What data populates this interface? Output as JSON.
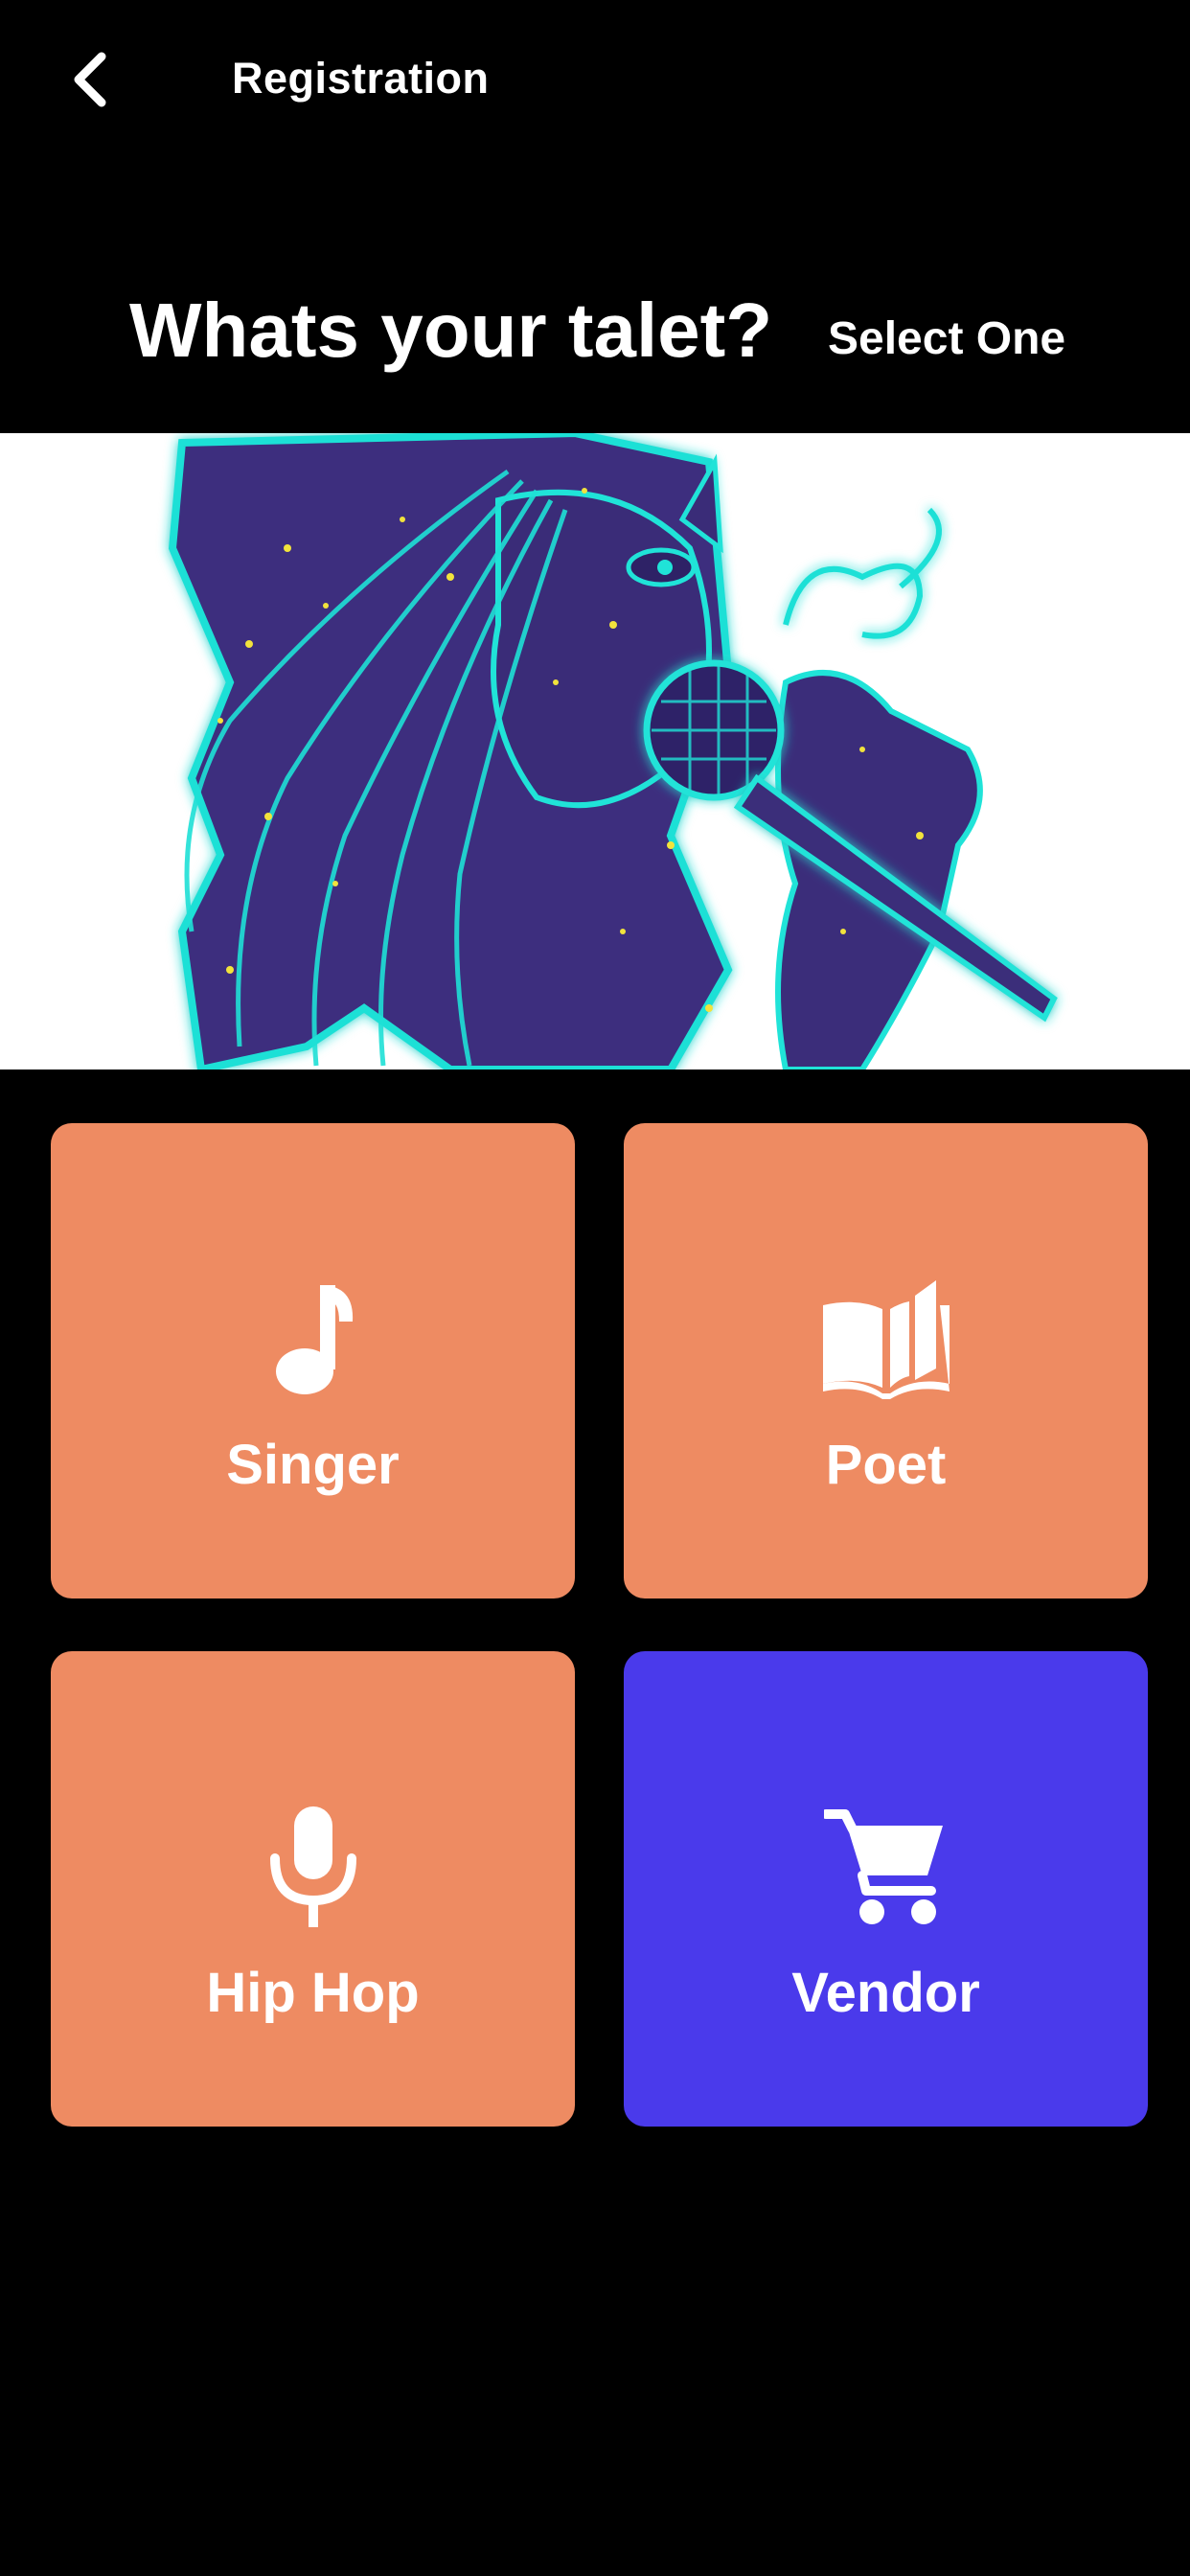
{
  "header": {
    "title": "Registration",
    "back_icon": "chevron-left-icon"
  },
  "question": {
    "text": "Whats your talet?",
    "hint": "Select One"
  },
  "hero": {
    "image": "singer-microphone-illustration"
  },
  "talents": [
    {
      "label": "Singer",
      "icon": "music-note-icon",
      "selected": false
    },
    {
      "label": "Poet",
      "icon": "open-book-icon",
      "selected": false
    },
    {
      "label": "Hip Hop",
      "icon": "microphone-icon",
      "selected": false
    },
    {
      "label": "Vendor",
      "icon": "shopping-cart-icon",
      "selected": true
    }
  ],
  "colors": {
    "background": "#000000",
    "tile": "#EE8B62",
    "tile_selected": "#4A3AEB",
    "text": "#FFFFFF"
  }
}
